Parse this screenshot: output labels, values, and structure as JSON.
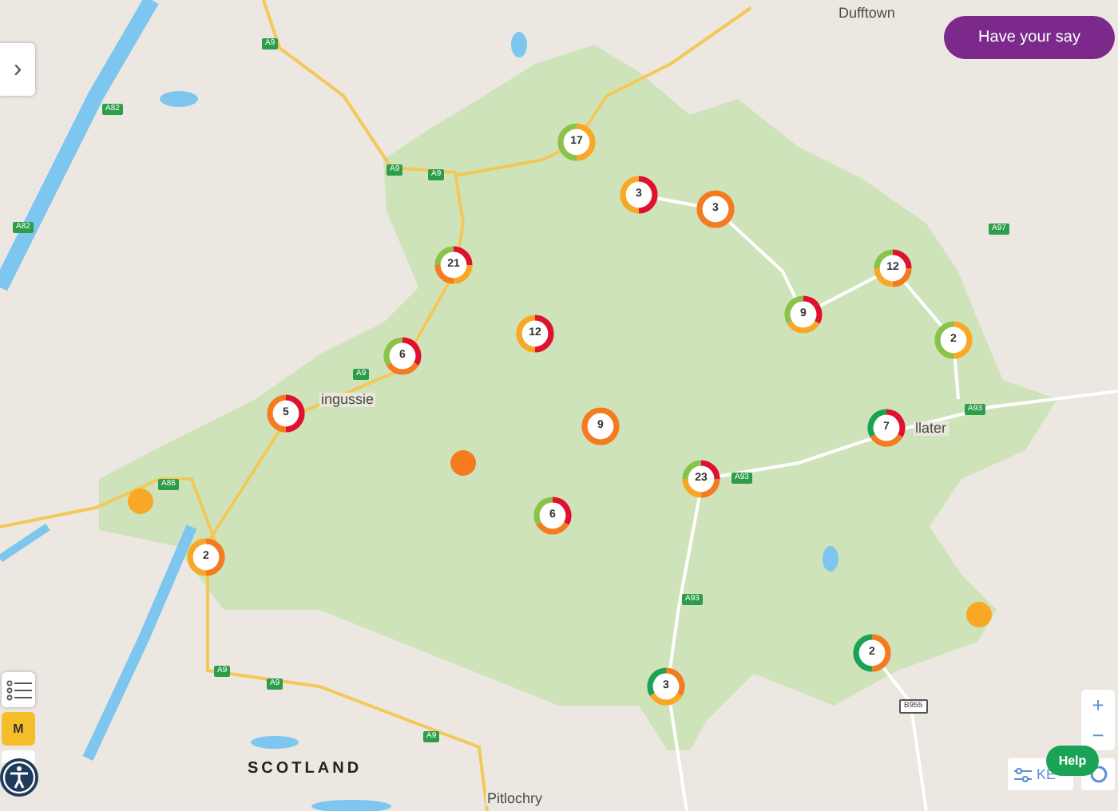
{
  "sidebar_toggle": {
    "label": "›"
  },
  "have_your_say": {
    "label": "Have your say"
  },
  "map_labels": [
    {
      "kind": "place",
      "text": "Dufftown"
    },
    {
      "kind": "place",
      "text": "ingussie"
    },
    {
      "kind": "place",
      "text": "llater"
    },
    {
      "kind": "region",
      "text": "SCOTLAND"
    },
    {
      "kind": "place",
      "text": "Pitlochry"
    },
    {
      "kind": "road",
      "text": "A82"
    },
    {
      "kind": "road",
      "text": "A82"
    },
    {
      "kind": "road",
      "text": "A9"
    },
    {
      "kind": "road",
      "text": "A9"
    },
    {
      "kind": "road",
      "text": "A9"
    },
    {
      "kind": "road",
      "text": "A9"
    },
    {
      "kind": "road",
      "text": "A9"
    },
    {
      "kind": "road",
      "text": "A9"
    },
    {
      "kind": "road",
      "text": "A9"
    },
    {
      "kind": "road",
      "text": "A86"
    },
    {
      "kind": "road",
      "text": "A93"
    },
    {
      "kind": "road",
      "text": "A93"
    },
    {
      "kind": "road",
      "text": "A93"
    },
    {
      "kind": "road",
      "text": "A97"
    },
    {
      "kind": "road",
      "text": "B955"
    }
  ],
  "markers": [
    {
      "kind": "cluster",
      "count": "17",
      "segments": [
        {
          "color": "#f9a825"
        },
        {
          "color": "#8bc34a"
        }
      ]
    },
    {
      "kind": "cluster",
      "count": "3",
      "segments": [
        {
          "color": "#e0102f"
        },
        {
          "color": "#f9a825"
        }
      ]
    },
    {
      "kind": "cluster",
      "count": "3",
      "segments": [
        {
          "color": "#f47b20"
        }
      ]
    },
    {
      "kind": "cluster",
      "count": "21",
      "segments": [
        {
          "color": "#e0102f"
        },
        {
          "color": "#f9a825"
        },
        {
          "color": "#f47b20"
        },
        {
          "color": "#8bc34a"
        }
      ]
    },
    {
      "kind": "cluster",
      "count": "12",
      "segments": [
        {
          "color": "#e0102f"
        },
        {
          "color": "#f47b20"
        },
        {
          "color": "#f9a825"
        },
        {
          "color": "#8bc34a"
        }
      ]
    },
    {
      "kind": "cluster",
      "count": "6",
      "segments": [
        {
          "color": "#e0102f"
        },
        {
          "color": "#f47b20"
        },
        {
          "color": "#8bc34a"
        }
      ]
    },
    {
      "kind": "cluster",
      "count": "12",
      "segments": [
        {
          "color": "#e0102f"
        },
        {
          "color": "#f9a825"
        }
      ]
    },
    {
      "kind": "cluster",
      "count": "9",
      "segments": [
        {
          "color": "#e0102f"
        },
        {
          "color": "#f9a825"
        },
        {
          "color": "#8bc34a"
        }
      ]
    },
    {
      "kind": "cluster",
      "count": "2",
      "segments": [
        {
          "color": "#f9a825"
        },
        {
          "color": "#8bc34a"
        }
      ]
    },
    {
      "kind": "cluster",
      "count": "5",
      "segments": [
        {
          "color": "#e0102f"
        },
        {
          "color": "#f47b20"
        }
      ]
    },
    {
      "kind": "cluster",
      "count": "9",
      "segments": [
        {
          "color": "#f47b20"
        }
      ]
    },
    {
      "kind": "cluster",
      "count": "7",
      "segments": [
        {
          "color": "#e0102f"
        },
        {
          "color": "#f47b20"
        },
        {
          "color": "#1aa354"
        }
      ]
    },
    {
      "kind": "cluster",
      "count": "23",
      "segments": [
        {
          "color": "#e0102f"
        },
        {
          "color": "#f47b20"
        },
        {
          "color": "#f9a825"
        },
        {
          "color": "#8bc34a"
        }
      ]
    },
    {
      "kind": "cluster",
      "count": "6",
      "segments": [
        {
          "color": "#e0102f"
        },
        {
          "color": "#f47b20"
        },
        {
          "color": "#8bc34a"
        }
      ]
    },
    {
      "kind": "cluster",
      "count": "2",
      "segments": [
        {
          "color": "#f47b20"
        },
        {
          "color": "#f9a825"
        }
      ]
    },
    {
      "kind": "cluster",
      "count": "2",
      "segments": [
        {
          "color": "#f47b20"
        },
        {
          "color": "#1aa354"
        }
      ]
    },
    {
      "kind": "cluster",
      "count": "3",
      "segments": [
        {
          "color": "#f47b20"
        },
        {
          "color": "#f9a825"
        },
        {
          "color": "#1aa354"
        }
      ]
    },
    {
      "kind": "point",
      "color": "#f47b20"
    },
    {
      "kind": "point",
      "color": "#f9a825"
    },
    {
      "kind": "point",
      "color": "#f9a825"
    }
  ],
  "left_controls": {
    "m_button": "M"
  },
  "zoom": {
    "in": "+",
    "out": "−"
  },
  "key_button": {
    "label": "KE"
  },
  "help_button": {
    "label": "Help"
  }
}
